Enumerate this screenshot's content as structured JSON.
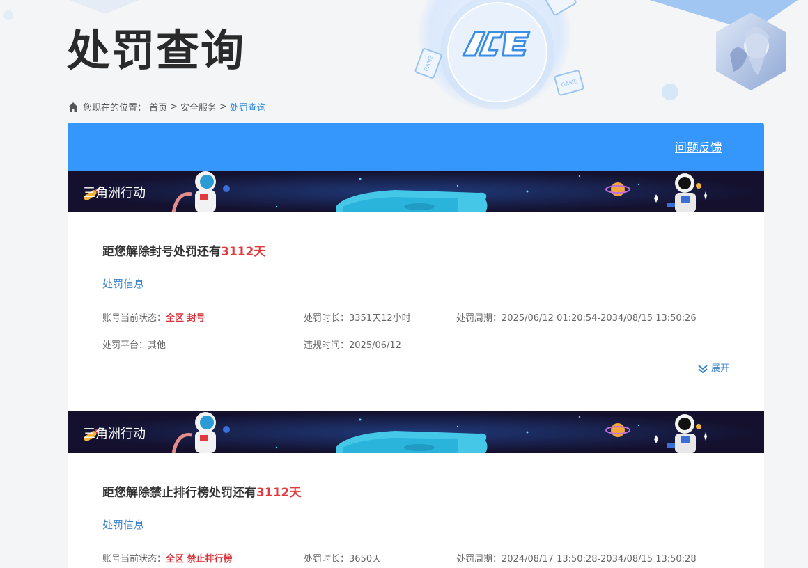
{
  "page": {
    "title": "处罚查询"
  },
  "breadcrumb": {
    "prefix": "您现在的位置：",
    "home": "首页",
    "sep": ">",
    "security": "安全服务",
    "current": "处罚查询"
  },
  "header": {
    "logo_text": "ACE",
    "game_tag": "GAME"
  },
  "panel": {
    "feedback_label": "问题反馈"
  },
  "punishments": [
    {
      "game_name": "三角洲行动",
      "headline_prefix": "距您解除封号处罚还有",
      "days_left": "3112天",
      "section_title": "处罚信息",
      "status_label": "账号当前状态：",
      "status_value": "全区 封号",
      "duration_label": "处罚时长：",
      "duration_value": "3351天12小时",
      "period_label": "处罚周期：",
      "period_value": "2025/06/12 01:20:54-2034/08/15 13:50:26",
      "platform_label": "处罚平台：",
      "platform_value": "其他",
      "violation_label": "违规时间：",
      "violation_value": "2025/06/12",
      "expand_label": "展开"
    },
    {
      "game_name": "三角洲行动",
      "headline_prefix": "距您解除禁止排行榜处罚还有",
      "days_left": "3112天",
      "section_title": "处罚信息",
      "status_label": "账号当前状态：",
      "status_value": "全区 禁止排行榜",
      "duration_label": "处罚时长：",
      "duration_value": "3650天",
      "period_label": "处罚周期：",
      "period_value": "2024/08/17 13:50:28-2034/08/15 13:50:28"
    }
  ],
  "colors": {
    "accent_blue": "#3596fc",
    "red": "#e0393e",
    "link_blue": "#3a82c8"
  }
}
